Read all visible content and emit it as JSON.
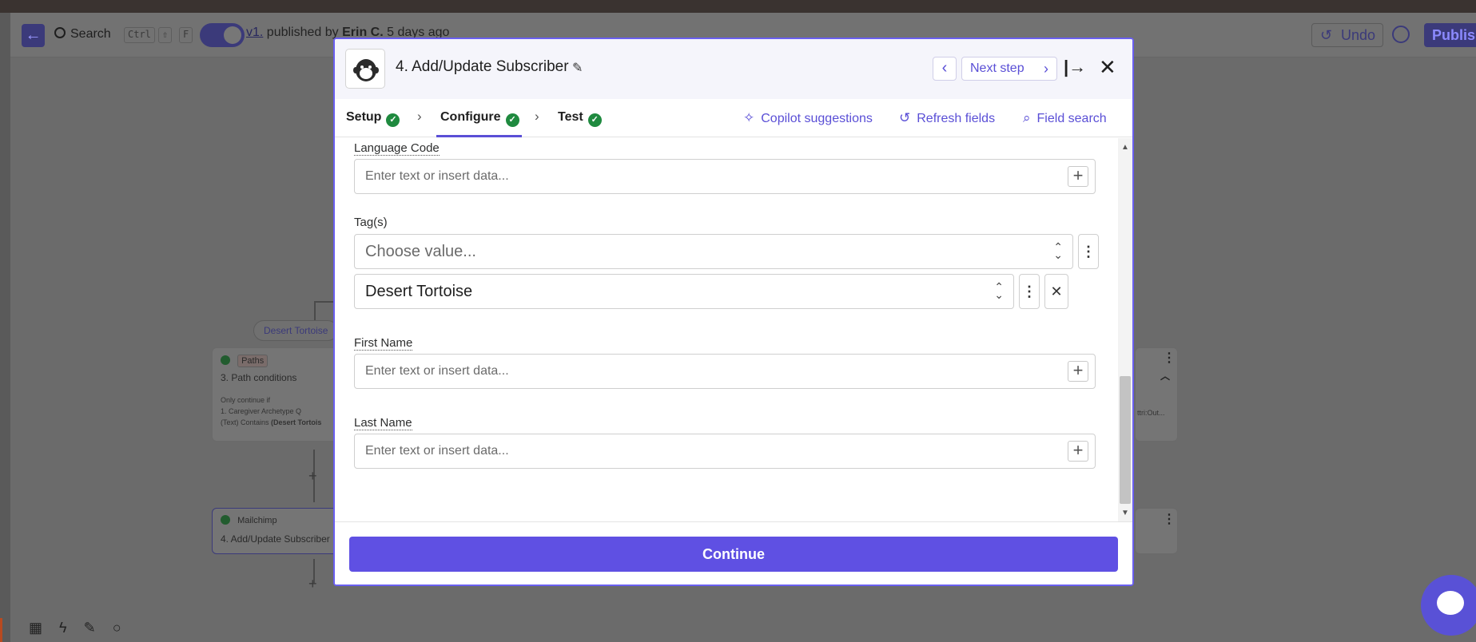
{
  "editor": {
    "search_label": "Search",
    "shortcut_keys": [
      "Ctrl",
      "⇧",
      "F"
    ],
    "version_label": "v1.",
    "published_prefix": "published by",
    "published_by": "Erin C.",
    "published_when": "5 days ago",
    "undo_label": "Undo",
    "publish_label": "Publish"
  },
  "canvas": {
    "path_pill": "Desert Tortoise",
    "paths_card": {
      "badge": "Paths",
      "title": "3. Path conditions",
      "line1": "Only continue if",
      "line2": "1. Caregiver Archetype Q",
      "line3": "(Text) Contains",
      "line3_value": "(Desert Tortois"
    },
    "mailchimp_card": {
      "app": "Mailchimp",
      "title": "4. Add/Update Subscriber"
    },
    "right_card_snippet": "ttri:Out..."
  },
  "modal": {
    "title": "4.  Add/Update Subscriber",
    "next_step_label": "Next step",
    "tabs": [
      {
        "label": "Setup"
      },
      {
        "label": "Configure"
      },
      {
        "label": "Test"
      }
    ],
    "tools": {
      "copilot": "Copilot suggestions",
      "refresh": "Refresh fields",
      "field_search": "Field search"
    },
    "fields": {
      "language_code": {
        "label": "Language Code",
        "placeholder": "Enter text or insert data..."
      },
      "tags": {
        "label": "Tag(s)",
        "choose_placeholder": "Choose value...",
        "selected_value": "Desert Tortoise"
      },
      "first_name": {
        "label": "First Name",
        "placeholder": "Enter text or insert data..."
      },
      "last_name": {
        "label": "Last Name",
        "placeholder": "Enter text or insert data..."
      }
    },
    "continue_label": "Continue"
  },
  "colors": {
    "accent": "#5f50e3",
    "success": "#1f8a3f",
    "overlay": "#6b6b6b"
  }
}
